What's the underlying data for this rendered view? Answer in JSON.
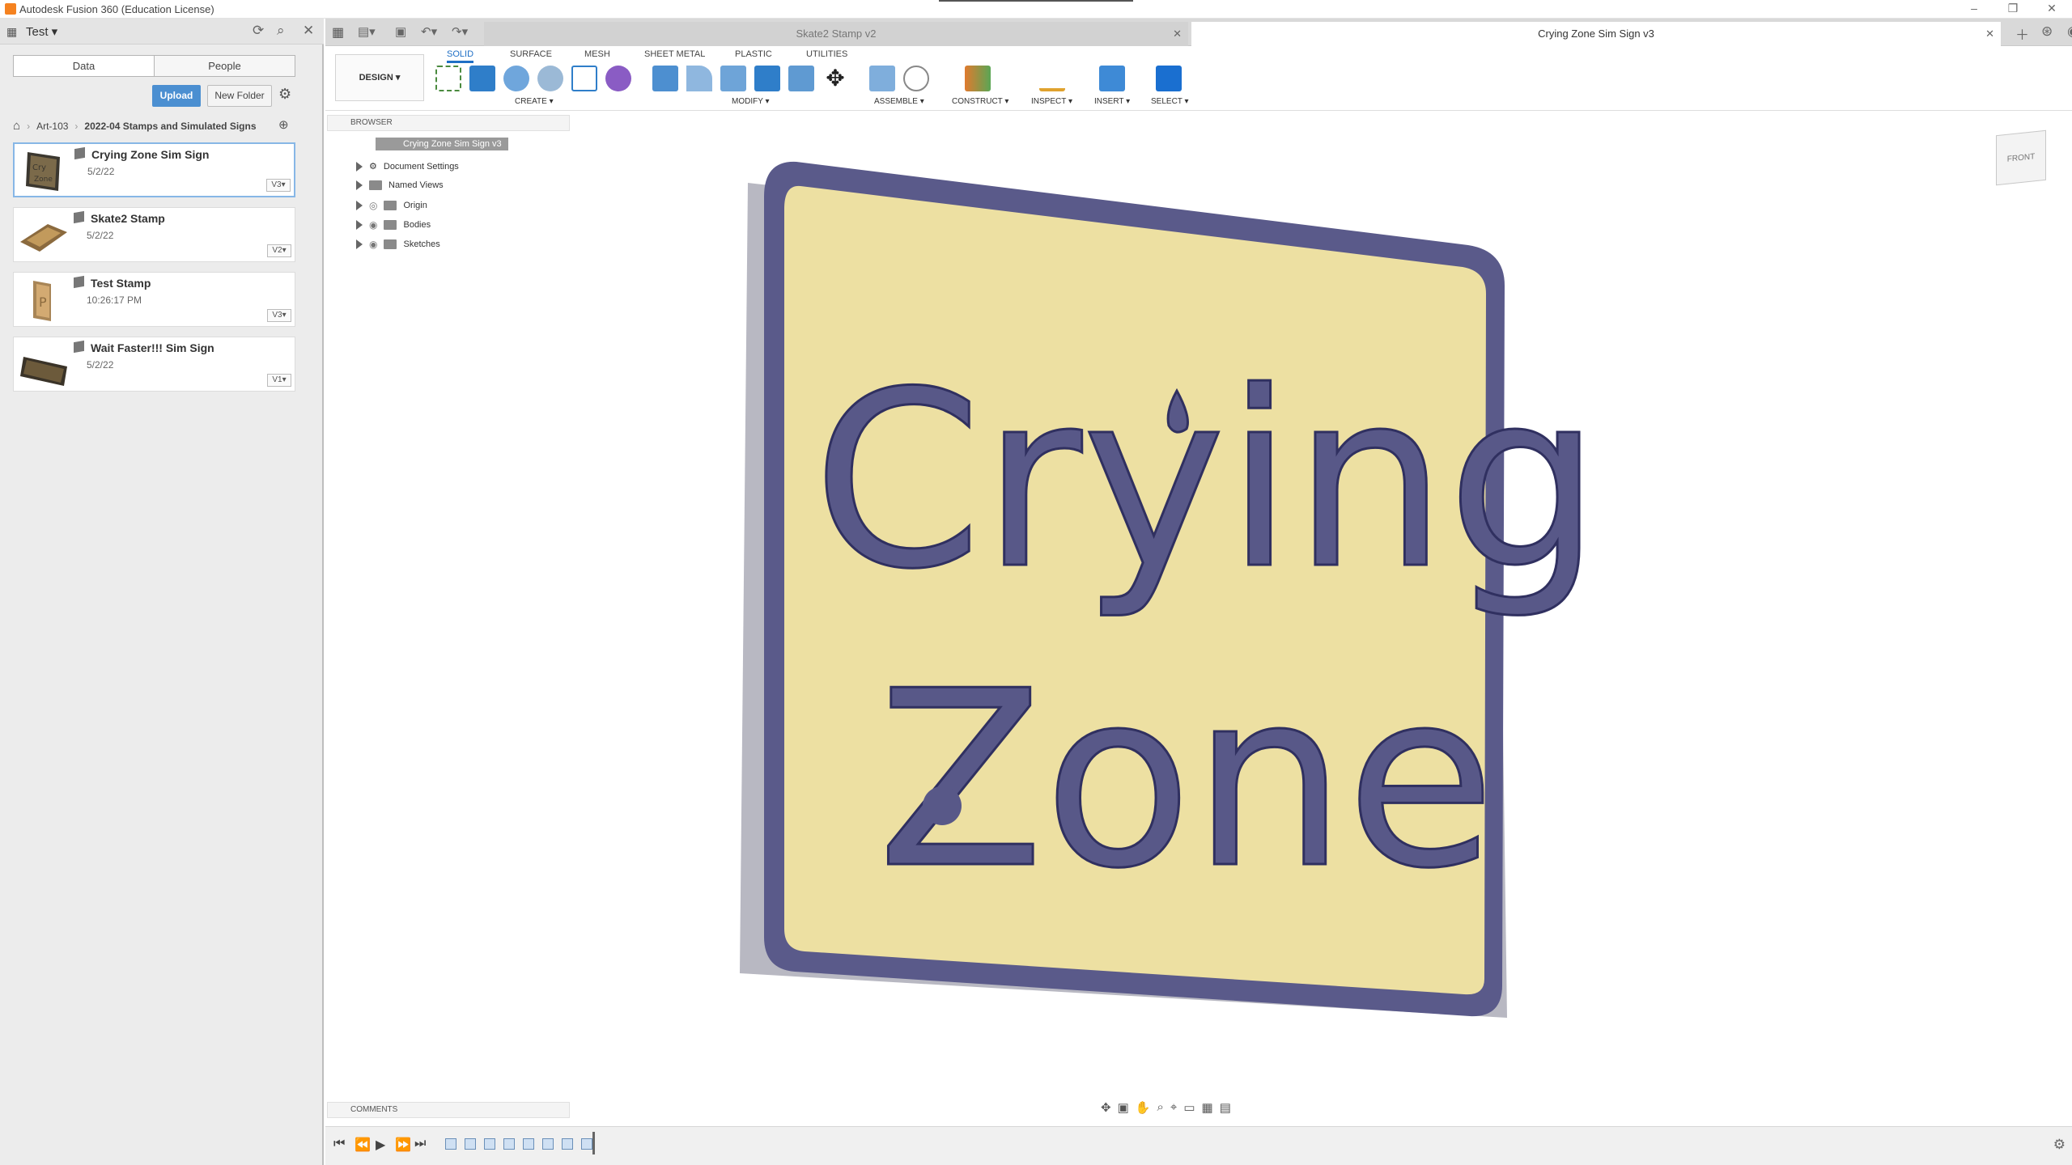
{
  "app": {
    "title": "Autodesk Fusion 360 (Education License)"
  },
  "data_panel": {
    "project": "Test",
    "tabs": [
      "Data",
      "People"
    ],
    "upload": "Upload",
    "new_folder": "New Folder",
    "breadcrumb": [
      "Art-103",
      "2022-04 Stamps and Simulated Signs"
    ],
    "files": [
      {
        "name": "Crying Zone Sim Sign",
        "date": "5/2/22",
        "version": "V3"
      },
      {
        "name": "Skate2 Stamp",
        "date": "5/2/22",
        "version": "V2"
      },
      {
        "name": "Test Stamp",
        "date": "10:26:17 PM",
        "version": "V3"
      },
      {
        "name": "Wait Faster!!! Sim Sign",
        "date": "5/2/22",
        "version": "V1"
      }
    ]
  },
  "doc_tabs": [
    {
      "label": "Skate2 Stamp v2"
    },
    {
      "label": "Crying Zone Sim Sign v3"
    }
  ],
  "toolbar": {
    "workspace": "DESIGN",
    "tabs": [
      "SOLID",
      "SURFACE",
      "MESH",
      "SHEET METAL",
      "PLASTIC",
      "UTILITIES"
    ],
    "groups": [
      "CREATE",
      "MODIFY",
      "ASSEMBLE",
      "CONSTRUCT",
      "INSPECT",
      "INSERT",
      "SELECT"
    ]
  },
  "browser": {
    "title": "BROWSER",
    "root": "Crying Zone Sim Sign v3",
    "nodes": [
      "Document Settings",
      "Named Views",
      "Origin",
      "Bodies",
      "Sketches"
    ]
  },
  "viewcube": {
    "face": "FRONT"
  },
  "model": {
    "line1": "Crying",
    "line2": "Zone"
  },
  "comments": {
    "label": "COMMENTS"
  }
}
